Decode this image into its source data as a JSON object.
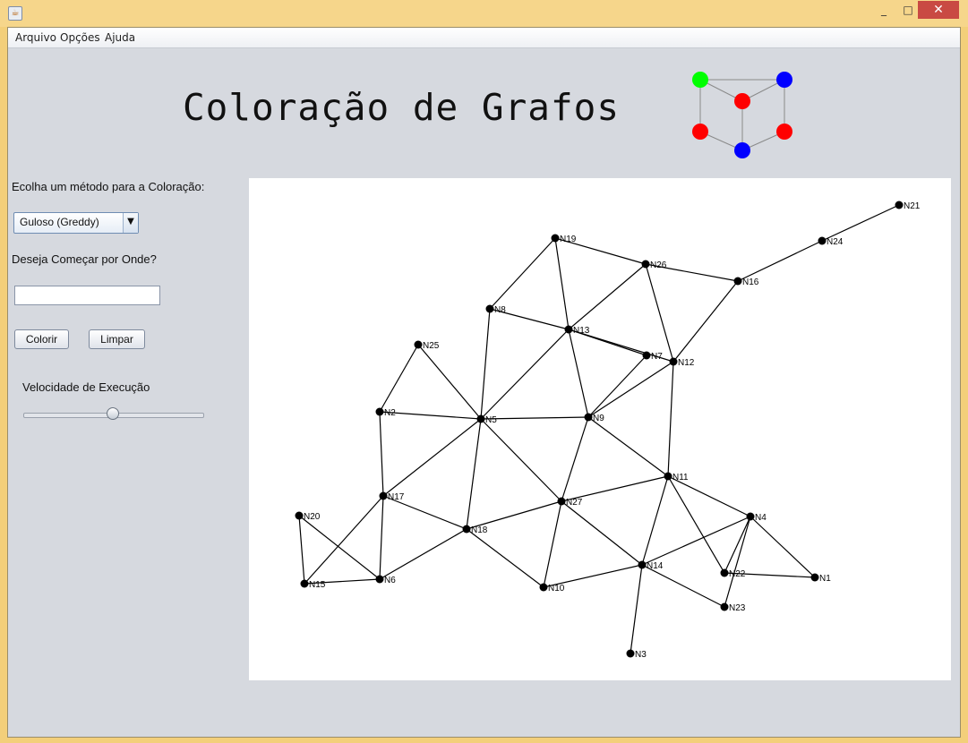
{
  "window": {
    "minimize_glyph": "_",
    "maximize_glyph": "□",
    "close_glyph": "✕",
    "app_icon": "java-cup-icon"
  },
  "menu": {
    "items": [
      "Arquivo",
      "Opções",
      "Ajuda"
    ]
  },
  "header": {
    "title": "Coloração de Grafos"
  },
  "logo_colors": {
    "green": "#00ff00",
    "blue": "#0000ff",
    "red": "#ff0000",
    "edge": "#8a8a8a"
  },
  "sidebar": {
    "method_label": "Ecolha um método para a Coloração:",
    "method_selected": "Guloso (Greddy)",
    "start_label": "Deseja Começar por Onde?",
    "start_value": "",
    "color_button": "Colorir",
    "clear_button": "Limpar",
    "speed_label": "Velocidade de Execução",
    "speed_value": 0.5
  },
  "graph": {
    "nodes": [
      {
        "id": "N1",
        "label": "N1"
      },
      {
        "id": "N2",
        "label": "N2"
      },
      {
        "id": "N3",
        "label": "N3"
      },
      {
        "id": "N4",
        "label": "N4"
      },
      {
        "id": "N5",
        "label": "N5"
      },
      {
        "id": "N6",
        "label": "N6"
      },
      {
        "id": "N7",
        "label": "N7"
      },
      {
        "id": "N8",
        "label": "N8"
      },
      {
        "id": "N9",
        "label": "N9"
      },
      {
        "id": "N10",
        "label": "N10"
      },
      {
        "id": "N11",
        "label": "N11"
      },
      {
        "id": "N12",
        "label": "N12"
      },
      {
        "id": "N13",
        "label": "N13"
      },
      {
        "id": "N14",
        "label": "N14"
      },
      {
        "id": "N15",
        "label": "N15"
      },
      {
        "id": "N16",
        "label": "N16"
      },
      {
        "id": "N17",
        "label": "N17"
      },
      {
        "id": "N18",
        "label": "N18"
      },
      {
        "id": "N19",
        "label": "N19"
      },
      {
        "id": "N20",
        "label": "N20"
      },
      {
        "id": "N21",
        "label": "N21"
      },
      {
        "id": "N22",
        "label": "N22"
      },
      {
        "id": "N23",
        "label": "N23"
      },
      {
        "id": "N24",
        "label": "N24"
      },
      {
        "id": "N25",
        "label": "N25"
      },
      {
        "id": "N26",
        "label": "N26"
      },
      {
        "id": "N27",
        "label": "N27"
      }
    ],
    "edges": [
      [
        "N21",
        "N24"
      ],
      [
        "N24",
        "N16"
      ],
      [
        "N16",
        "N26"
      ],
      [
        "N16",
        "N12"
      ],
      [
        "N19",
        "N26"
      ],
      [
        "N19",
        "N8"
      ],
      [
        "N19",
        "N13"
      ],
      [
        "N26",
        "N13"
      ],
      [
        "N26",
        "N12"
      ],
      [
        "N8",
        "N13"
      ],
      [
        "N8",
        "N5"
      ],
      [
        "N13",
        "N7"
      ],
      [
        "N13",
        "N12"
      ],
      [
        "N13",
        "N9"
      ],
      [
        "N13",
        "N5"
      ],
      [
        "N7",
        "N9"
      ],
      [
        "N12",
        "N9"
      ],
      [
        "N12",
        "N11"
      ],
      [
        "N25",
        "N2"
      ],
      [
        "N25",
        "N5"
      ],
      [
        "N2",
        "N5"
      ],
      [
        "N2",
        "N17"
      ],
      [
        "N5",
        "N9"
      ],
      [
        "N5",
        "N17"
      ],
      [
        "N5",
        "N18"
      ],
      [
        "N5",
        "N27"
      ],
      [
        "N9",
        "N27"
      ],
      [
        "N9",
        "N11"
      ],
      [
        "N11",
        "N27"
      ],
      [
        "N11",
        "N14"
      ],
      [
        "N11",
        "N4"
      ],
      [
        "N11",
        "N22"
      ],
      [
        "N27",
        "N18"
      ],
      [
        "N27",
        "N10"
      ],
      [
        "N27",
        "N14"
      ],
      [
        "N17",
        "N18"
      ],
      [
        "N17",
        "N6"
      ],
      [
        "N17",
        "N15"
      ],
      [
        "N20",
        "N15"
      ],
      [
        "N20",
        "N6"
      ],
      [
        "N15",
        "N6"
      ],
      [
        "N6",
        "N18"
      ],
      [
        "N18",
        "N10"
      ],
      [
        "N10",
        "N14"
      ],
      [
        "N14",
        "N3"
      ],
      [
        "N14",
        "N23"
      ],
      [
        "N14",
        "N4"
      ],
      [
        "N4",
        "N22"
      ],
      [
        "N4",
        "N23"
      ],
      [
        "N4",
        "N1"
      ],
      [
        "N22",
        "N1"
      ]
    ]
  }
}
